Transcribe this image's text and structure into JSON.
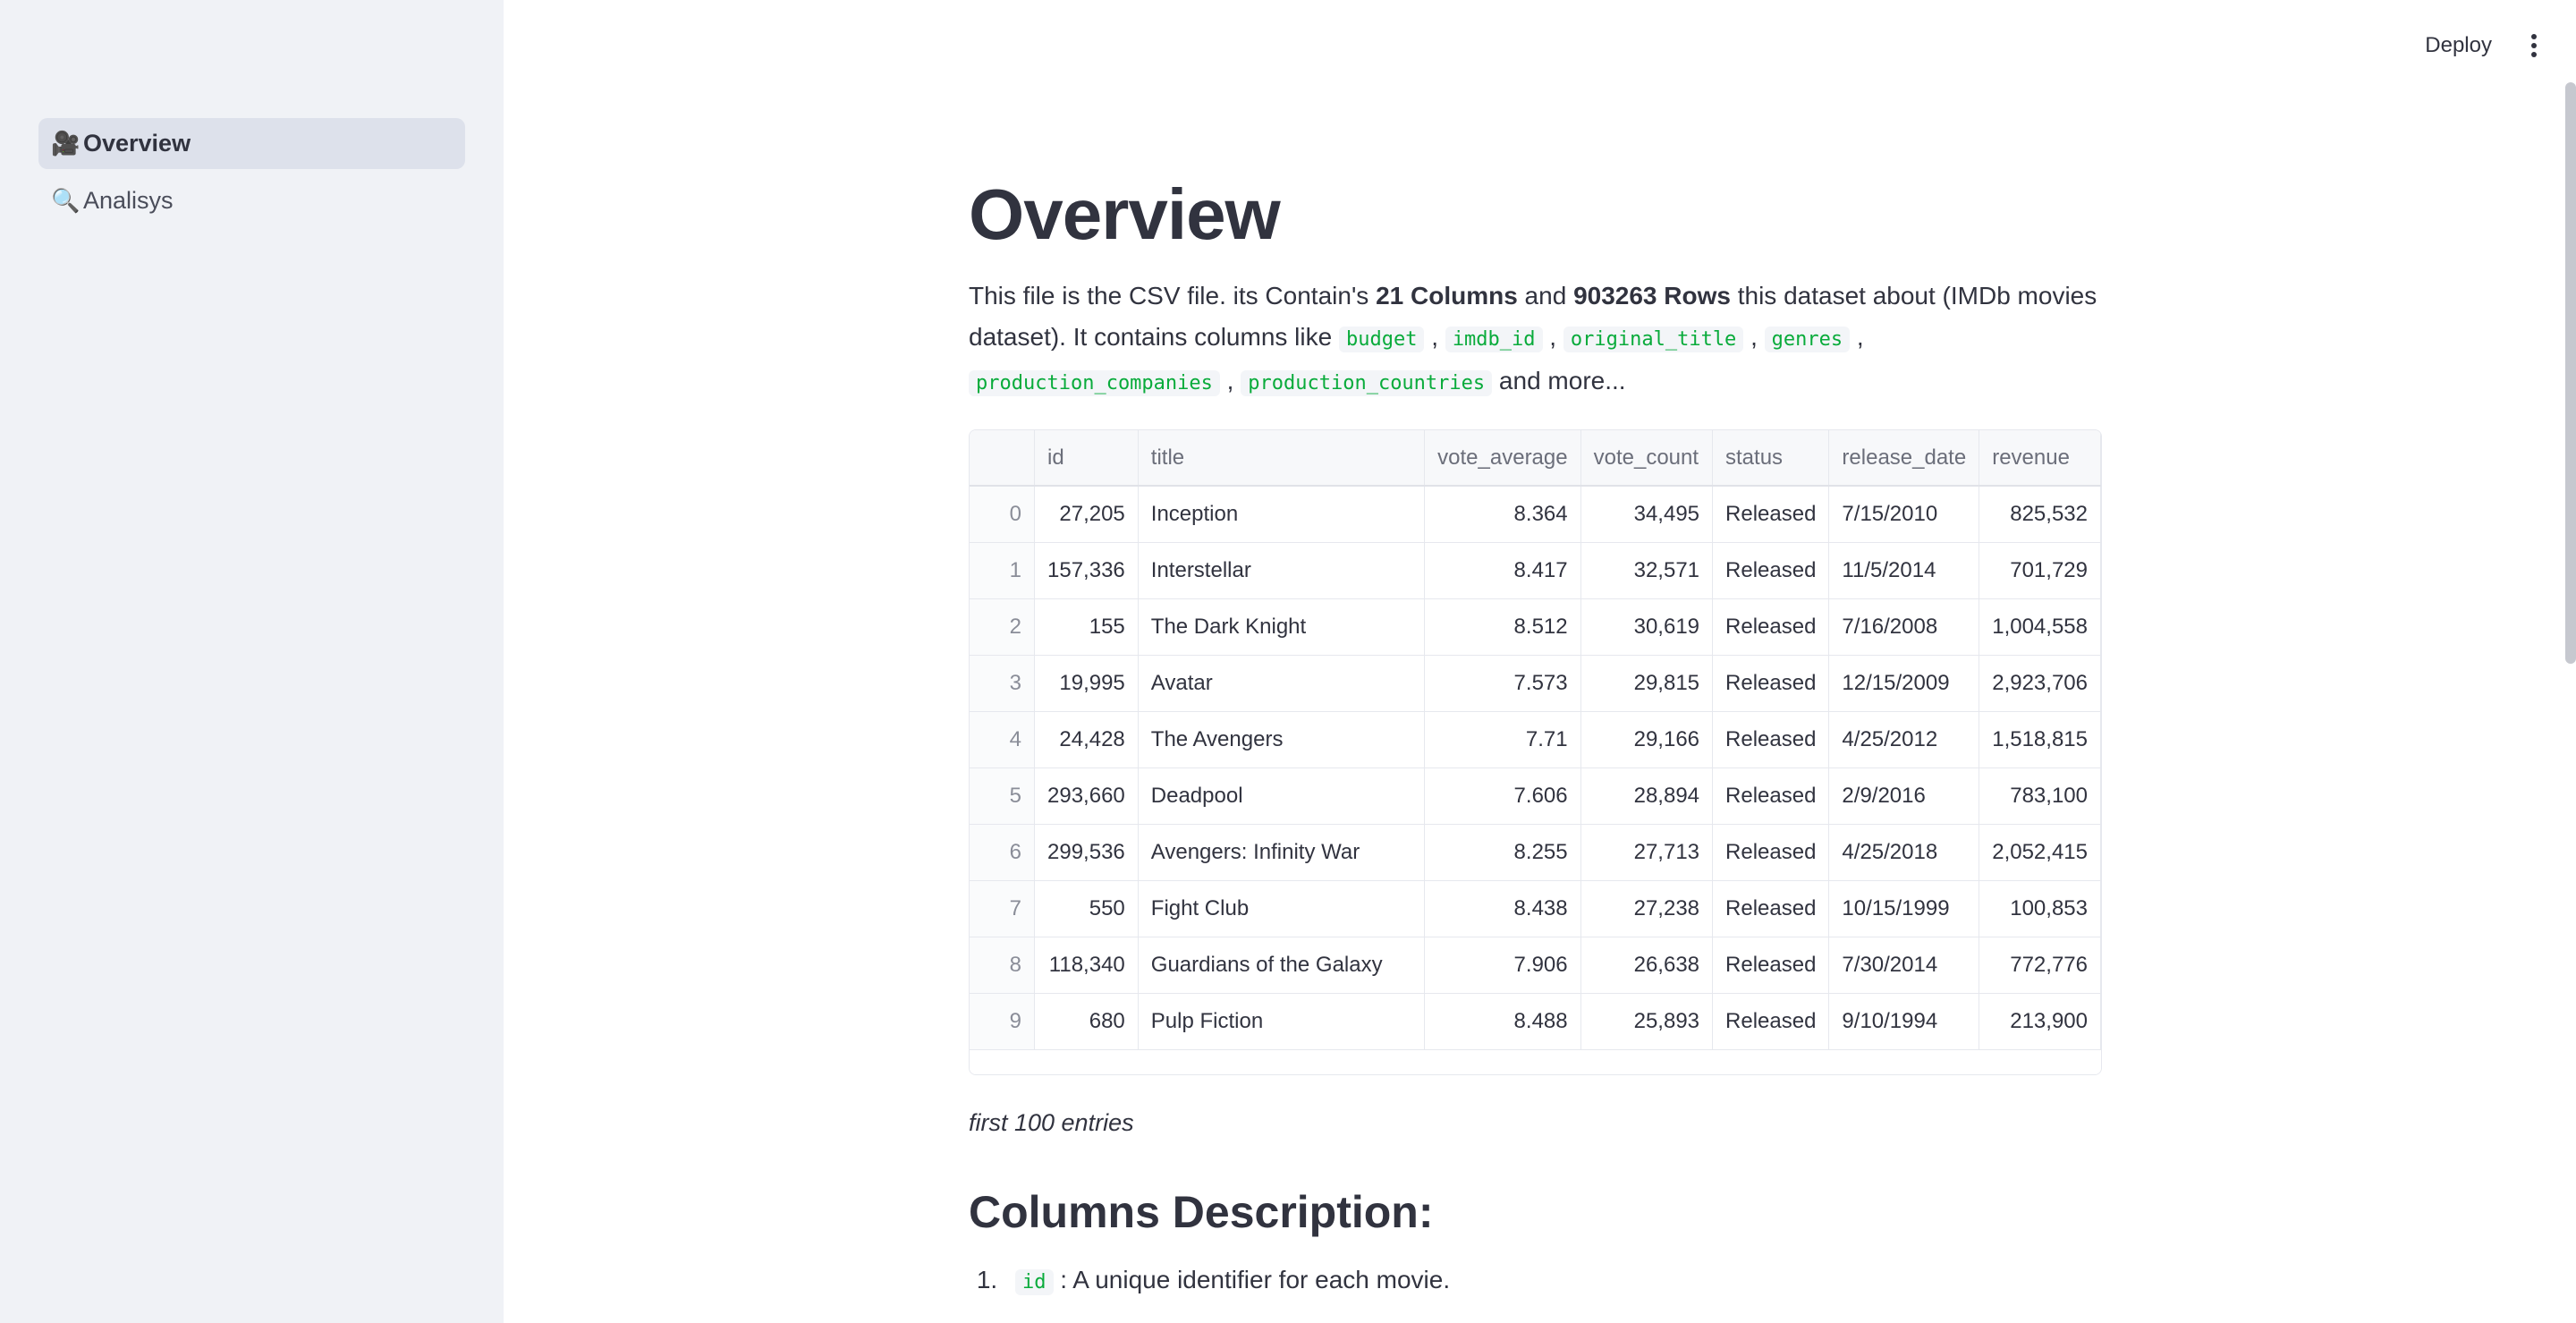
{
  "header": {
    "deploy_label": "Deploy"
  },
  "sidebar": {
    "items": [
      {
        "emoji": "🎥",
        "label": "Overview",
        "active": true
      },
      {
        "emoji": "🔍",
        "label": "Analisys",
        "active": false
      }
    ]
  },
  "main": {
    "title": "Overview",
    "intro": {
      "p1": "This file is the CSV file. its Contain's ",
      "cols": "21 Columns",
      "p2": " and ",
      "rows": "903263 Rows",
      "p3": " this dataset about (IMDb movies dataset). It contains columns like ",
      "tags": [
        "budget",
        "imdb_id",
        "original_title",
        "genres",
        "production_companies",
        "production_countries"
      ],
      "tail": " and more..."
    },
    "table": {
      "columns": [
        "",
        "id",
        "title",
        "vote_average",
        "vote_count",
        "status",
        "release_date",
        "revenue"
      ],
      "rows": [
        [
          "0",
          "27,205",
          "Inception",
          "8.364",
          "34,495",
          "Released",
          "7/15/2010",
          "825,532"
        ],
        [
          "1",
          "157,336",
          "Interstellar",
          "8.417",
          "32,571",
          "Released",
          "11/5/2014",
          "701,729"
        ],
        [
          "2",
          "155",
          "The Dark Knight",
          "8.512",
          "30,619",
          "Released",
          "7/16/2008",
          "1,004,558"
        ],
        [
          "3",
          "19,995",
          "Avatar",
          "7.573",
          "29,815",
          "Released",
          "12/15/2009",
          "2,923,706"
        ],
        [
          "4",
          "24,428",
          "The Avengers",
          "7.71",
          "29,166",
          "Released",
          "4/25/2012",
          "1,518,815"
        ],
        [
          "5",
          "293,660",
          "Deadpool",
          "7.606",
          "28,894",
          "Released",
          "2/9/2016",
          "783,100"
        ],
        [
          "6",
          "299,536",
          "Avengers: Infinity War",
          "8.255",
          "27,713",
          "Released",
          "4/25/2018",
          "2,052,415"
        ],
        [
          "7",
          "550",
          "Fight Club",
          "8.438",
          "27,238",
          "Released",
          "10/15/1999",
          "100,853"
        ],
        [
          "8",
          "118,340",
          "Guardians of the Galaxy",
          "7.906",
          "26,638",
          "Released",
          "7/30/2014",
          "772,776"
        ],
        [
          "9",
          "680",
          "Pulp Fiction",
          "8.488",
          "25,893",
          "Released",
          "9/10/1994",
          "213,900"
        ]
      ]
    },
    "caption": "first 100 entries",
    "section_title": "Columns Description:",
    "desc_items": [
      {
        "code": "id",
        "text": " : A unique identifier for each movie."
      }
    ]
  }
}
